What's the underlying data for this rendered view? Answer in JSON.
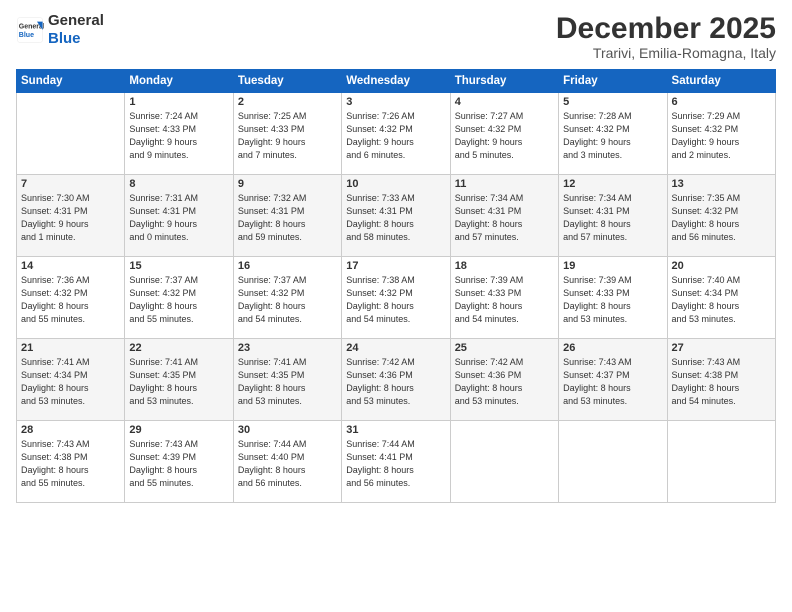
{
  "logo": {
    "line1": "General",
    "line2": "Blue"
  },
  "title": "December 2025",
  "location": "Trarivi, Emilia-Romagna, Italy",
  "weekdays": [
    "Sunday",
    "Monday",
    "Tuesday",
    "Wednesday",
    "Thursday",
    "Friday",
    "Saturday"
  ],
  "weeks": [
    [
      {
        "day": "",
        "info": ""
      },
      {
        "day": "1",
        "info": "Sunrise: 7:24 AM\nSunset: 4:33 PM\nDaylight: 9 hours\nand 9 minutes."
      },
      {
        "day": "2",
        "info": "Sunrise: 7:25 AM\nSunset: 4:33 PM\nDaylight: 9 hours\nand 7 minutes."
      },
      {
        "day": "3",
        "info": "Sunrise: 7:26 AM\nSunset: 4:32 PM\nDaylight: 9 hours\nand 6 minutes."
      },
      {
        "day": "4",
        "info": "Sunrise: 7:27 AM\nSunset: 4:32 PM\nDaylight: 9 hours\nand 5 minutes."
      },
      {
        "day": "5",
        "info": "Sunrise: 7:28 AM\nSunset: 4:32 PM\nDaylight: 9 hours\nand 3 minutes."
      },
      {
        "day": "6",
        "info": "Sunrise: 7:29 AM\nSunset: 4:32 PM\nDaylight: 9 hours\nand 2 minutes."
      }
    ],
    [
      {
        "day": "7",
        "info": "Sunrise: 7:30 AM\nSunset: 4:31 PM\nDaylight: 9 hours\nand 1 minute."
      },
      {
        "day": "8",
        "info": "Sunrise: 7:31 AM\nSunset: 4:31 PM\nDaylight: 9 hours\nand 0 minutes."
      },
      {
        "day": "9",
        "info": "Sunrise: 7:32 AM\nSunset: 4:31 PM\nDaylight: 8 hours\nand 59 minutes."
      },
      {
        "day": "10",
        "info": "Sunrise: 7:33 AM\nSunset: 4:31 PM\nDaylight: 8 hours\nand 58 minutes."
      },
      {
        "day": "11",
        "info": "Sunrise: 7:34 AM\nSunset: 4:31 PM\nDaylight: 8 hours\nand 57 minutes."
      },
      {
        "day": "12",
        "info": "Sunrise: 7:34 AM\nSunset: 4:31 PM\nDaylight: 8 hours\nand 57 minutes."
      },
      {
        "day": "13",
        "info": "Sunrise: 7:35 AM\nSunset: 4:32 PM\nDaylight: 8 hours\nand 56 minutes."
      }
    ],
    [
      {
        "day": "14",
        "info": "Sunrise: 7:36 AM\nSunset: 4:32 PM\nDaylight: 8 hours\nand 55 minutes."
      },
      {
        "day": "15",
        "info": "Sunrise: 7:37 AM\nSunset: 4:32 PM\nDaylight: 8 hours\nand 55 minutes."
      },
      {
        "day": "16",
        "info": "Sunrise: 7:37 AM\nSunset: 4:32 PM\nDaylight: 8 hours\nand 54 minutes."
      },
      {
        "day": "17",
        "info": "Sunrise: 7:38 AM\nSunset: 4:32 PM\nDaylight: 8 hours\nand 54 minutes."
      },
      {
        "day": "18",
        "info": "Sunrise: 7:39 AM\nSunset: 4:33 PM\nDaylight: 8 hours\nand 54 minutes."
      },
      {
        "day": "19",
        "info": "Sunrise: 7:39 AM\nSunset: 4:33 PM\nDaylight: 8 hours\nand 53 minutes."
      },
      {
        "day": "20",
        "info": "Sunrise: 7:40 AM\nSunset: 4:34 PM\nDaylight: 8 hours\nand 53 minutes."
      }
    ],
    [
      {
        "day": "21",
        "info": "Sunrise: 7:41 AM\nSunset: 4:34 PM\nDaylight: 8 hours\nand 53 minutes."
      },
      {
        "day": "22",
        "info": "Sunrise: 7:41 AM\nSunset: 4:35 PM\nDaylight: 8 hours\nand 53 minutes."
      },
      {
        "day": "23",
        "info": "Sunrise: 7:41 AM\nSunset: 4:35 PM\nDaylight: 8 hours\nand 53 minutes."
      },
      {
        "day": "24",
        "info": "Sunrise: 7:42 AM\nSunset: 4:36 PM\nDaylight: 8 hours\nand 53 minutes."
      },
      {
        "day": "25",
        "info": "Sunrise: 7:42 AM\nSunset: 4:36 PM\nDaylight: 8 hours\nand 53 minutes."
      },
      {
        "day": "26",
        "info": "Sunrise: 7:43 AM\nSunset: 4:37 PM\nDaylight: 8 hours\nand 53 minutes."
      },
      {
        "day": "27",
        "info": "Sunrise: 7:43 AM\nSunset: 4:38 PM\nDaylight: 8 hours\nand 54 minutes."
      }
    ],
    [
      {
        "day": "28",
        "info": "Sunrise: 7:43 AM\nSunset: 4:38 PM\nDaylight: 8 hours\nand 55 minutes."
      },
      {
        "day": "29",
        "info": "Sunrise: 7:43 AM\nSunset: 4:39 PM\nDaylight: 8 hours\nand 55 minutes."
      },
      {
        "day": "30",
        "info": "Sunrise: 7:44 AM\nSunset: 4:40 PM\nDaylight: 8 hours\nand 56 minutes."
      },
      {
        "day": "31",
        "info": "Sunrise: 7:44 AM\nSunset: 4:41 PM\nDaylight: 8 hours\nand 56 minutes."
      },
      {
        "day": "",
        "info": ""
      },
      {
        "day": "",
        "info": ""
      },
      {
        "day": "",
        "info": ""
      }
    ]
  ]
}
